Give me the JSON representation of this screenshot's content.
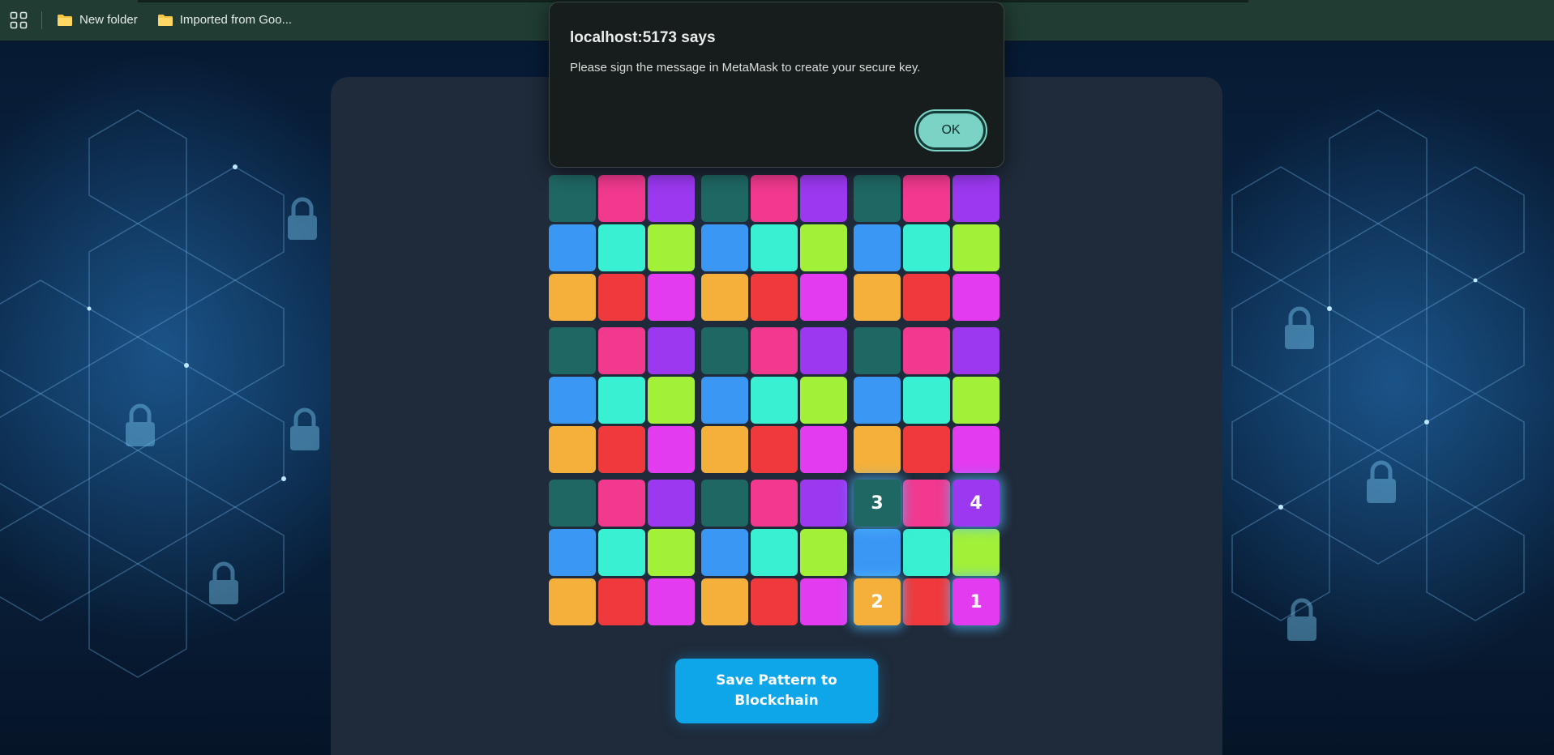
{
  "bookmarks": [
    {
      "label": "New folder"
    },
    {
      "label": "Imported from Goo..."
    }
  ],
  "alert": {
    "title": "localhost:5173 says",
    "message": "Please sign the message in MetaMask to create your secure key.",
    "ok_label": "OK"
  },
  "pattern_grid": {
    "color_cycle": [
      "#1f6763",
      "#f0398f",
      "#9b38f0",
      "#3b97f4",
      "#39f0d2",
      "#a3f039",
      "#f4b03b",
      "#f0393c",
      "#e23bf0"
    ],
    "selected": [
      {
        "block": 8,
        "cell": 0,
        "order": "3"
      },
      {
        "block": 8,
        "cell": 2,
        "order": "4"
      },
      {
        "block": 8,
        "cell": 6,
        "order": "2"
      },
      {
        "block": 8,
        "cell": 8,
        "order": "1"
      }
    ]
  },
  "save_button": {
    "line1": "Save Pattern to",
    "line2": "Blockchain"
  }
}
